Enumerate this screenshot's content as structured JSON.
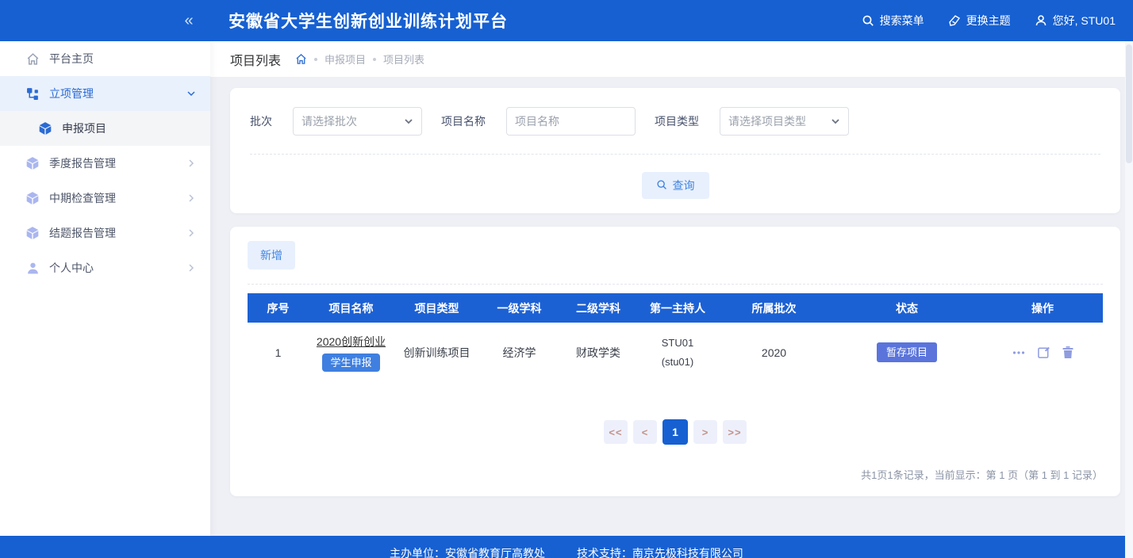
{
  "header": {
    "title": "安徽省大学生创新创业训练计划平台",
    "collapse_icon": "«",
    "search_label": "搜索菜单",
    "theme_label": "更换主题",
    "user_label": "您好, STU01"
  },
  "sidebar": {
    "items": [
      {
        "label": "平台主页"
      },
      {
        "label": "立项管理"
      },
      {
        "label": "申报项目"
      },
      {
        "label": "季度报告管理"
      },
      {
        "label": "中期检查管理"
      },
      {
        "label": "结题报告管理"
      },
      {
        "label": "个人中心"
      }
    ]
  },
  "breadcrumb": {
    "page_title": "项目列表",
    "crumb1": "申报项目",
    "crumb2": "项目列表"
  },
  "filters": {
    "batch_label": "批次",
    "batch_placeholder": "请选择批次",
    "name_label": "项目名称",
    "name_placeholder": "项目名称",
    "type_label": "项目类型",
    "type_placeholder": "请选择项目类型",
    "query_button": "查询"
  },
  "toolbar": {
    "add_button": "新增"
  },
  "table": {
    "columns": [
      "序号",
      "项目名称",
      "项目类型",
      "一级学科",
      "二级学科",
      "第一主持人",
      "所属批次",
      "状态",
      "操作"
    ],
    "rows": [
      {
        "index": "1",
        "name": "2020创新创业",
        "name_badge": "学生申报",
        "type": "创新训练项目",
        "discipline1": "经济学",
        "discipline2": "财政学类",
        "leader_line1": "STU01",
        "leader_line2": "(stu01)",
        "batch": "2020",
        "status": "暂存项目"
      }
    ]
  },
  "pagination": {
    "first": "<<",
    "prev": "<",
    "current": "1",
    "next": ">",
    "last": ">>",
    "summary": "共1页1条记录，当前显示：第 1 页（第 1 到 1 记录）"
  },
  "footer": {
    "org": "主办单位：安徽省教育厅高教处",
    "tech": "技术支持：南京先极科技有限公司"
  },
  "colors": {
    "primary": "#1660d2",
    "status_badge": "#5a74dc",
    "apply_badge": "#3f7fe0"
  }
}
